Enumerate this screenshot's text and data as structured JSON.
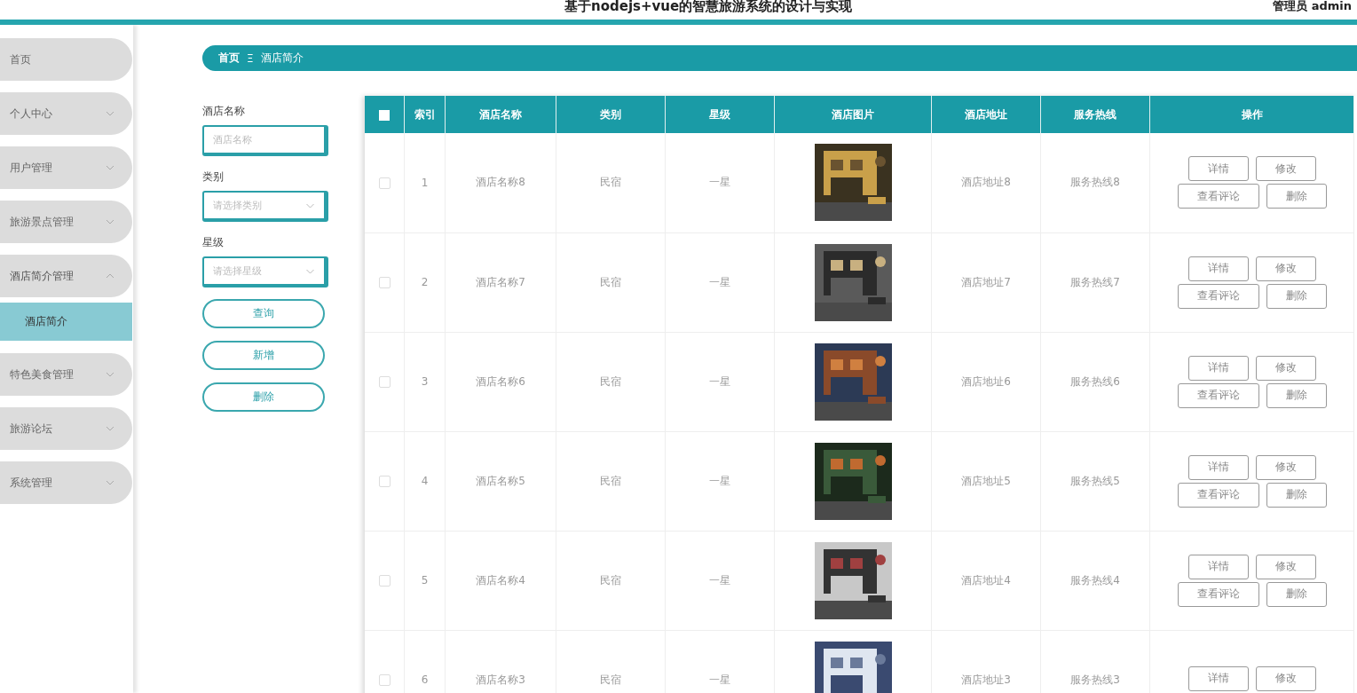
{
  "header": {
    "title": "基于nodejs+vue的智慧旅游系统的设计与实现",
    "user": "管理员 admin"
  },
  "sidebar": {
    "items": [
      {
        "label": "首页"
      },
      {
        "label": "个人中心",
        "expanded": false
      },
      {
        "label": "用户管理",
        "expanded": false
      },
      {
        "label": "旅游景点管理",
        "expanded": false
      },
      {
        "label": "酒店简介管理",
        "expanded": true,
        "children": [
          {
            "label": "酒店简介",
            "selected": true
          }
        ]
      },
      {
        "label": "特色美食管理",
        "expanded": false
      },
      {
        "label": "旅游论坛",
        "expanded": false
      },
      {
        "label": "系统管理",
        "expanded": false
      }
    ]
  },
  "breadcrumb": {
    "home": "首页",
    "separator": "Ξ",
    "current": "酒店简介"
  },
  "filters": [
    {
      "label": "酒店名称",
      "kind": "text",
      "placeholder": "酒店名称"
    },
    {
      "label": "类别",
      "kind": "select",
      "placeholder": "请选择类别"
    },
    {
      "label": "星级",
      "kind": "select",
      "placeholder": "请选择星级"
    }
  ],
  "actions": [
    "查询",
    "新增",
    "删除"
  ],
  "table": {
    "columns": [
      "索引",
      "酒店名称",
      "类别",
      "星级",
      "酒店图片",
      "酒店地址",
      "服务热线",
      "操作"
    ],
    "header_checked": false,
    "rows": [
      {
        "checked": false,
        "index": "1",
        "name": "酒店名称8",
        "category": "民宿",
        "star": "一星",
        "picture": {
          "kind": "picture"
        },
        "address": "酒店地址8",
        "hotline": "服务热线8",
        "actions": [
          "详情",
          "修改",
          "查看评论",
          "删除"
        ]
      },
      {
        "checked": false,
        "index": "2",
        "name": "酒店名称7",
        "category": "民宿",
        "star": "一星",
        "picture": {
          "kind": "picture"
        },
        "address": "酒店地址7",
        "hotline": "服务热线7",
        "actions": [
          "详情",
          "修改",
          "查看评论",
          "删除"
        ]
      },
      {
        "checked": false,
        "index": "3",
        "name": "酒店名称6",
        "category": "民宿",
        "star": "一星",
        "picture": {
          "kind": "picture"
        },
        "address": "酒店地址6",
        "hotline": "服务热线6",
        "actions": [
          "详情",
          "修改",
          "查看评论",
          "删除"
        ]
      },
      {
        "checked": false,
        "index": "4",
        "name": "酒店名称5",
        "category": "民宿",
        "star": "一星",
        "picture": {
          "kind": "picture"
        },
        "address": "酒店地址5",
        "hotline": "服务热线5",
        "actions": [
          "详情",
          "修改",
          "查看评论",
          "删除"
        ]
      },
      {
        "checked": false,
        "index": "5",
        "name": "酒店名称4",
        "category": "民宿",
        "star": "一星",
        "picture": {
          "kind": "picture"
        },
        "address": "酒店地址4",
        "hotline": "服务热线4",
        "actions": [
          "详情",
          "修改",
          "查看评论",
          "删除"
        ]
      },
      {
        "checked": false,
        "index": "6",
        "name": "酒店名称3",
        "category": "民宿",
        "star": "一星",
        "picture": {
          "kind": "picture"
        },
        "address": "酒店地址3",
        "hotline": "服务热线3",
        "actions": [
          "详情",
          "修改"
        ]
      }
    ]
  }
}
